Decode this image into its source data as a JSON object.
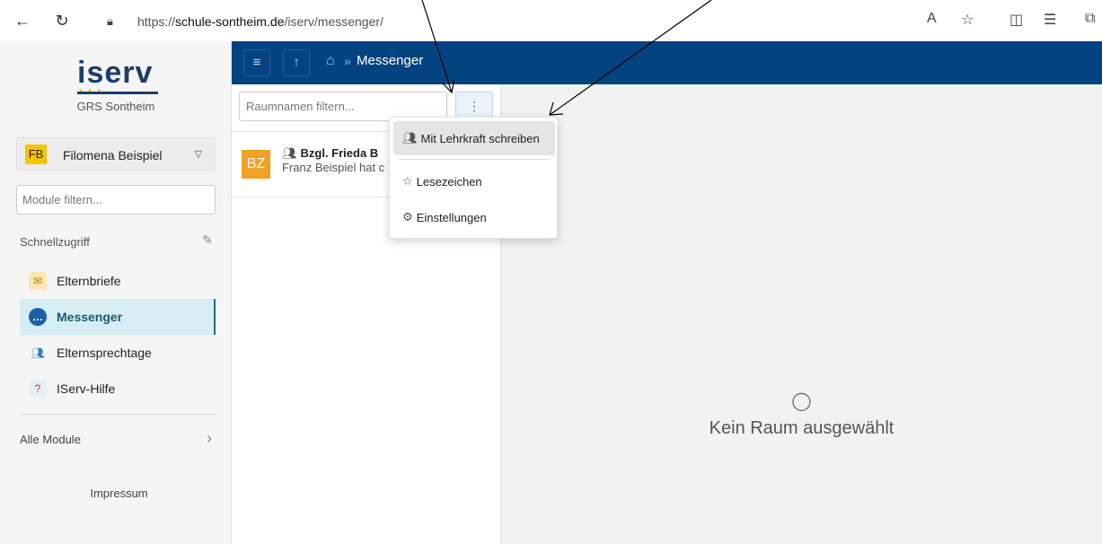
{
  "browser": {
    "url_prefix": "https://",
    "url_host": "schule-sontheim.de",
    "url_path": "/iserv/messenger/"
  },
  "sidebar": {
    "logo_text": "iserv",
    "school_name": "GRS Sontheim",
    "user_initials": "FB",
    "user_name": "Filomena Beispiel",
    "module_filter_placeholder": "Module filtern...",
    "quick_access_label": "Schnellzugriff",
    "items": [
      {
        "label": "Elternbriefe",
        "icon": "letter-icon"
      },
      {
        "label": "Messenger",
        "icon": "chat-icon",
        "active": true
      },
      {
        "label": "Elternsprechtage",
        "icon": "people-icon"
      },
      {
        "label": "IServ-Hilfe",
        "icon": "help-icon"
      }
    ],
    "all_modules_label": "Alle Module",
    "impressum_label": "Impressum"
  },
  "topbar": {
    "breadcrumb_sep": "»",
    "title": "Messenger",
    "accent": "#034480"
  },
  "rooms": {
    "filter_placeholder": "Raumnamen filtern...",
    "kebab_label": "⋮",
    "list": [
      {
        "initials": "BZ",
        "title": "Bzgl. Frieda B",
        "preview": "Franz Beispiel hat c"
      }
    ]
  },
  "menu": {
    "items": [
      {
        "label": "Mit Lehrkraft schreiben",
        "icon": "people-icon"
      },
      {
        "label": "Lesezeichen",
        "icon": "star-icon"
      },
      {
        "label": "Einstellungen",
        "icon": "gear-icon"
      }
    ]
  },
  "main": {
    "empty_text": "Kein Raum ausgewählt"
  }
}
